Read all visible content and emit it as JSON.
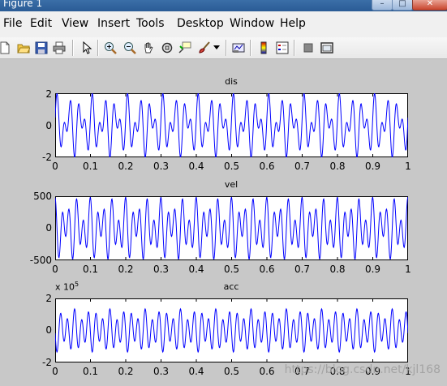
{
  "window": {
    "title": "Figure 1"
  },
  "menu": {
    "items": [
      {
        "label": "File",
        "name": "menu-file"
      },
      {
        "label": "Edit",
        "name": "menu-edit"
      },
      {
        "label": "View",
        "name": "menu-view"
      },
      {
        "label": "Insert",
        "name": "menu-insert"
      },
      {
        "label": "Tools",
        "name": "menu-tools"
      },
      {
        "label": "Desktop",
        "name": "menu-desktop"
      },
      {
        "label": "Window",
        "name": "menu-window"
      },
      {
        "label": "Help",
        "name": "menu-help"
      }
    ]
  },
  "toolbar": {
    "icons": [
      "new-figure-icon",
      "open-file-icon",
      "save-icon",
      "print-icon",
      "edit-plot-arrow-icon",
      "zoom-in-icon",
      "zoom-out-icon",
      "pan-hand-icon",
      "rotate-3d-icon",
      "data-cursor-icon",
      "brush-icon",
      "brush-dropdown-icon",
      "link-plot-icon",
      "colorbar-icon",
      "legend-icon",
      "hide-plot-tools-icon",
      "show-plot-tools-icon"
    ]
  },
  "watermark": "https://blog.csdn.net/kjl168",
  "chart_data": [
    {
      "type": "line",
      "title": "dis",
      "xlim": [
        0,
        1
      ],
      "ylim": [
        -2,
        2
      ],
      "xticks": [
        "0",
        "0.1",
        "0.2",
        "0.3",
        "0.4",
        "0.5",
        "0.6",
        "0.7",
        "0.8",
        "0.9",
        "1"
      ],
      "yticks": [
        "2",
        "0",
        "-2"
      ],
      "exponent": "",
      "series": [
        {
          "color": "#0000ff",
          "samples": 1000,
          "components": [
            {
              "amp": 1.0,
              "freq": 50,
              "phase": 0
            },
            {
              "amp": 1.0,
              "freq": 30,
              "phase": 0.5
            }
          ]
        }
      ]
    },
    {
      "type": "line",
      "title": "vel",
      "xlim": [
        0,
        1
      ],
      "ylim": [
        -500,
        500
      ],
      "xticks": [
        "0",
        "0.1",
        "0.2",
        "0.3",
        "0.4",
        "0.5",
        "0.6",
        "0.7",
        "0.8",
        "0.9",
        "1"
      ],
      "yticks": [
        "500",
        "0",
        "-500"
      ],
      "exponent": "",
      "series": [
        {
          "color": "#0000ff",
          "samples": 1000,
          "components": [
            {
              "amp": 314,
              "freq": 50,
              "phase": 1.5708
            },
            {
              "amp": 188,
              "freq": 30,
              "phase": 2.0708
            }
          ]
        }
      ]
    },
    {
      "type": "line",
      "title": "acc",
      "xlim": [
        0,
        1
      ],
      "ylim": [
        -2,
        2
      ],
      "xticks": [
        "0",
        "0.1",
        "0.2",
        "0.3",
        "0.4",
        "0.5",
        "0.6",
        "0.7",
        "0.8",
        "0.9",
        "1"
      ],
      "yticks": [
        "2",
        "0",
        "-2"
      ],
      "exponent": "x 10",
      "exponent_power": "5",
      "series": [
        {
          "color": "#0000ff",
          "samples": 1000,
          "components": [
            {
              "amp": 0.99,
              "freq": 50,
              "phase": 3.1416
            },
            {
              "amp": 0.36,
              "freq": 30,
              "phase": 3.6416
            }
          ]
        }
      ]
    }
  ]
}
